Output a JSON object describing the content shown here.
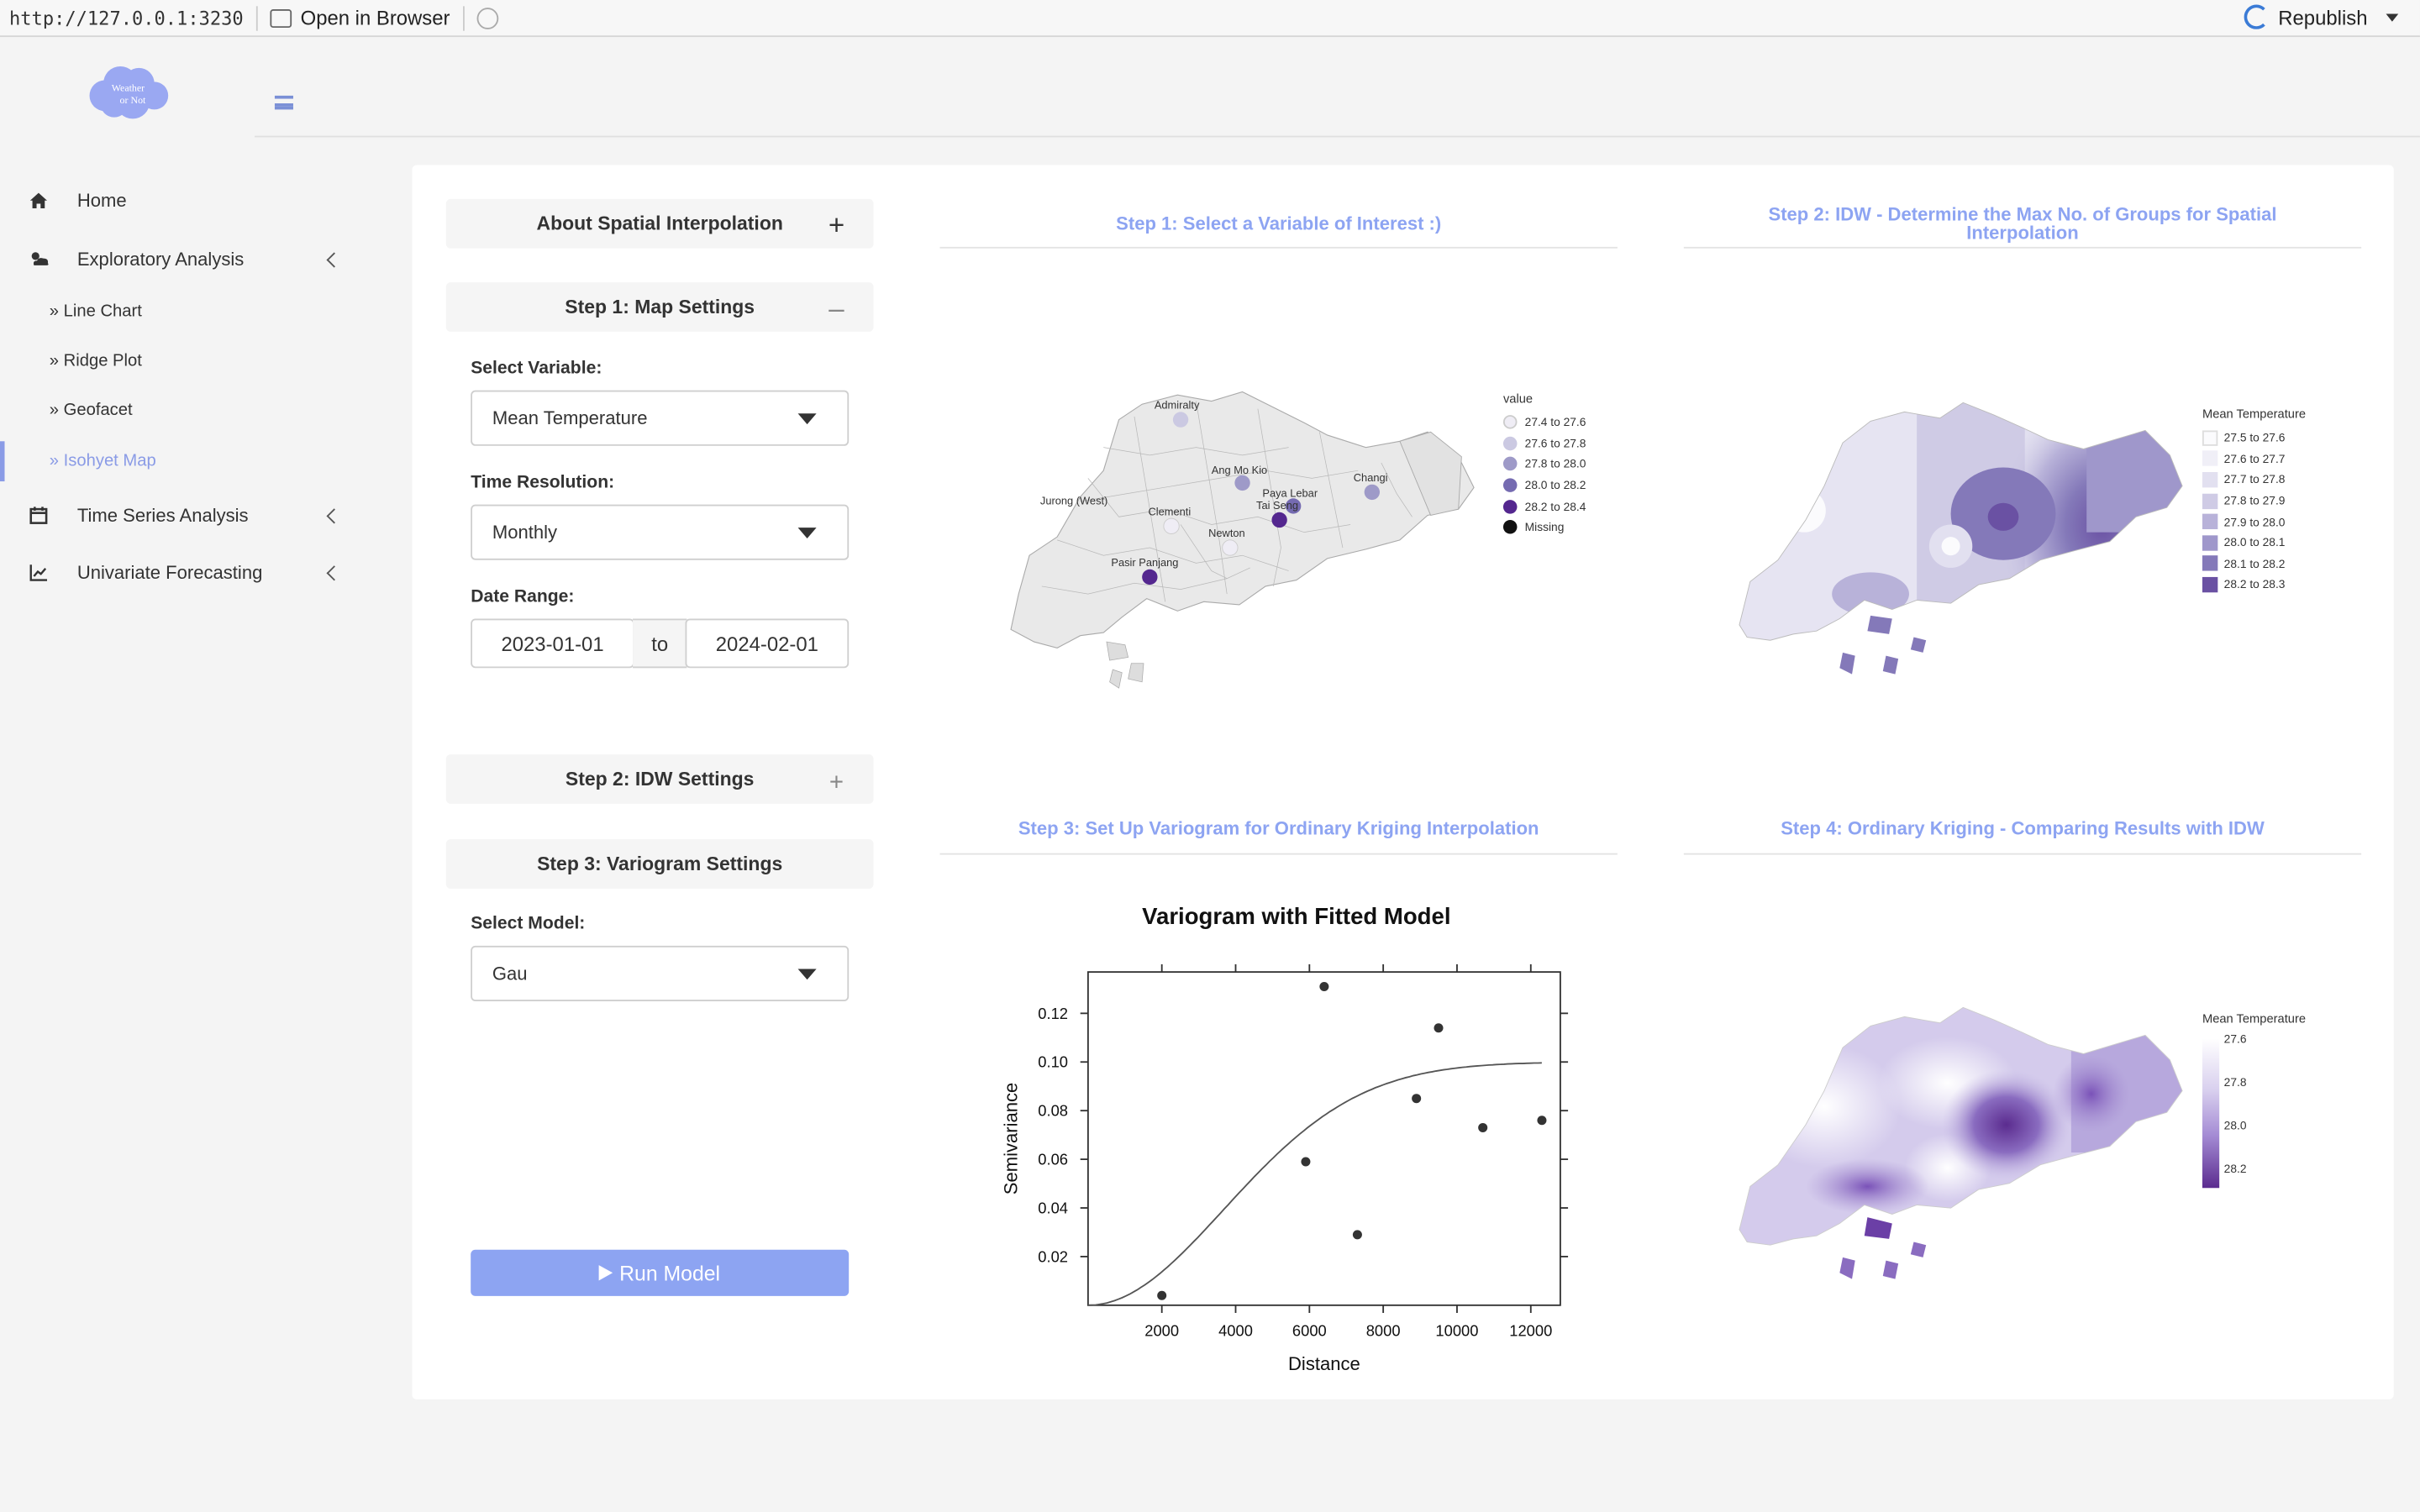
{
  "topbar": {
    "url": "http://127.0.0.1:3230",
    "open_in_browser": "Open in Browser",
    "republish": "Republish"
  },
  "logo": {
    "line1": "Weather",
    "line2": "or Not"
  },
  "sidebar": {
    "items": [
      {
        "label": "Home",
        "icon": "home-icon"
      },
      {
        "label": "Exploratory Analysis",
        "icon": "cloud-sun-icon"
      },
      {
        "label": "Time Series Analysis",
        "icon": "calendar-icon"
      },
      {
        "label": "Univariate Forecasting",
        "icon": "line-chart-icon"
      }
    ],
    "subitems": [
      {
        "label": "Line Chart"
      },
      {
        "label": "Ridge Plot"
      },
      {
        "label": "Geofacet"
      },
      {
        "label": "Isohyet Map",
        "active": true
      }
    ],
    "accent_color": "#8a9be6"
  },
  "controls": {
    "about": "About Spatial Interpolation",
    "step1": "Step 1: Map Settings",
    "select_variable_label": "Select Variable:",
    "select_variable_value": "Mean Temperature",
    "time_res_label": "Time Resolution:",
    "time_res_value": "Monthly",
    "date_range_label": "Date Range:",
    "date_from": "2023-01-01",
    "date_to_sep": "to",
    "date_to": "2024-02-01",
    "step2": "Step 2: IDW Settings",
    "step3": "Step 3: Variogram Settings",
    "select_model_label": "Select Model:",
    "select_model_value": "Gau",
    "run_button": "Run Model",
    "toggle_plus": "+",
    "toggle_minus": "–"
  },
  "panels": {
    "p1_title": "Step 1: Select a Variable of Interest :)",
    "p2_title_1": "Step 2: IDW - Determine the Max No. of Groups for Spatial",
    "p2_title_2": "Interpolation",
    "p3_title": "Step 3: Set Up Variogram for Ordinary Kriging Interpolation",
    "p4_title": "Step 4: Ordinary Kriging - Comparing Results with IDW"
  },
  "map1": {
    "legend_title": "value",
    "legend": [
      {
        "label": "27.4 to 27.6",
        "color": "#efedf5"
      },
      {
        "label": "27.6 to 27.8",
        "color": "#cbc9e2"
      },
      {
        "label": "27.8 to 28.0",
        "color": "#9e9ac8"
      },
      {
        "label": "28.0 to 28.2",
        "color": "#756bb1"
      },
      {
        "label": "28.2 to 28.4",
        "color": "#54278f"
      },
      {
        "label": "Missing",
        "color": "#111111"
      }
    ],
    "stations": [
      "Admiralty",
      "Ang Mo Kio",
      "Paya Lebar",
      "Tai Seng",
      "Changi",
      "Jurong (West)",
      "Clementi",
      "Newton",
      "Pasir Panjang"
    ]
  },
  "map2": {
    "legend_title": "Mean Temperature",
    "legend": [
      {
        "label": "27.5 to 27.6",
        "color": "#fbfbfd"
      },
      {
        "label": "27.6 to 27.7",
        "color": "#f0eff7"
      },
      {
        "label": "27.7 to 27.8",
        "color": "#e2e0f0"
      },
      {
        "label": "27.8 to 27.9",
        "color": "#cfcbe5"
      },
      {
        "label": "27.9 to 28.0",
        "color": "#b8b2d9"
      },
      {
        "label": "28.0 to 28.1",
        "color": "#9f97cb"
      },
      {
        "label": "28.1 to 28.2",
        "color": "#8479b9"
      },
      {
        "label": "28.2 to 28.3",
        "color": "#6a51a3"
      }
    ]
  },
  "map4": {
    "legend_title": "Mean Temperature",
    "ticks": [
      "27.6",
      "27.8",
      "28.0",
      "28.2"
    ]
  },
  "chart_data": {
    "type": "scatter",
    "title": "Variogram with Fitted Model",
    "xlabel": "Distance",
    "ylabel": "Semivariance",
    "xlim": [
      0,
      12800
    ],
    "ylim": [
      0,
      0.137
    ],
    "x_ticks": [
      2000,
      4000,
      6000,
      8000,
      10000,
      12000
    ],
    "y_ticks": [
      0.02,
      0.04,
      0.06,
      0.08,
      0.1,
      0.12
    ],
    "y_tick_labels": [
      "0.02",
      "0.04",
      "0.06",
      "0.08",
      "0.10",
      "0.12"
    ],
    "points": [
      {
        "x": 2000,
        "y": 0.004
      },
      {
        "x": 5900,
        "y": 0.059
      },
      {
        "x": 6400,
        "y": 0.131
      },
      {
        "x": 7300,
        "y": 0.029
      },
      {
        "x": 8900,
        "y": 0.085
      },
      {
        "x": 9500,
        "y": 0.114
      },
      {
        "x": 10700,
        "y": 0.073
      },
      {
        "x": 12300,
        "y": 0.076
      }
    ],
    "fitted_model": {
      "model": "Gau",
      "nugget": 0,
      "sill": 0.1,
      "range": 5200
    }
  }
}
